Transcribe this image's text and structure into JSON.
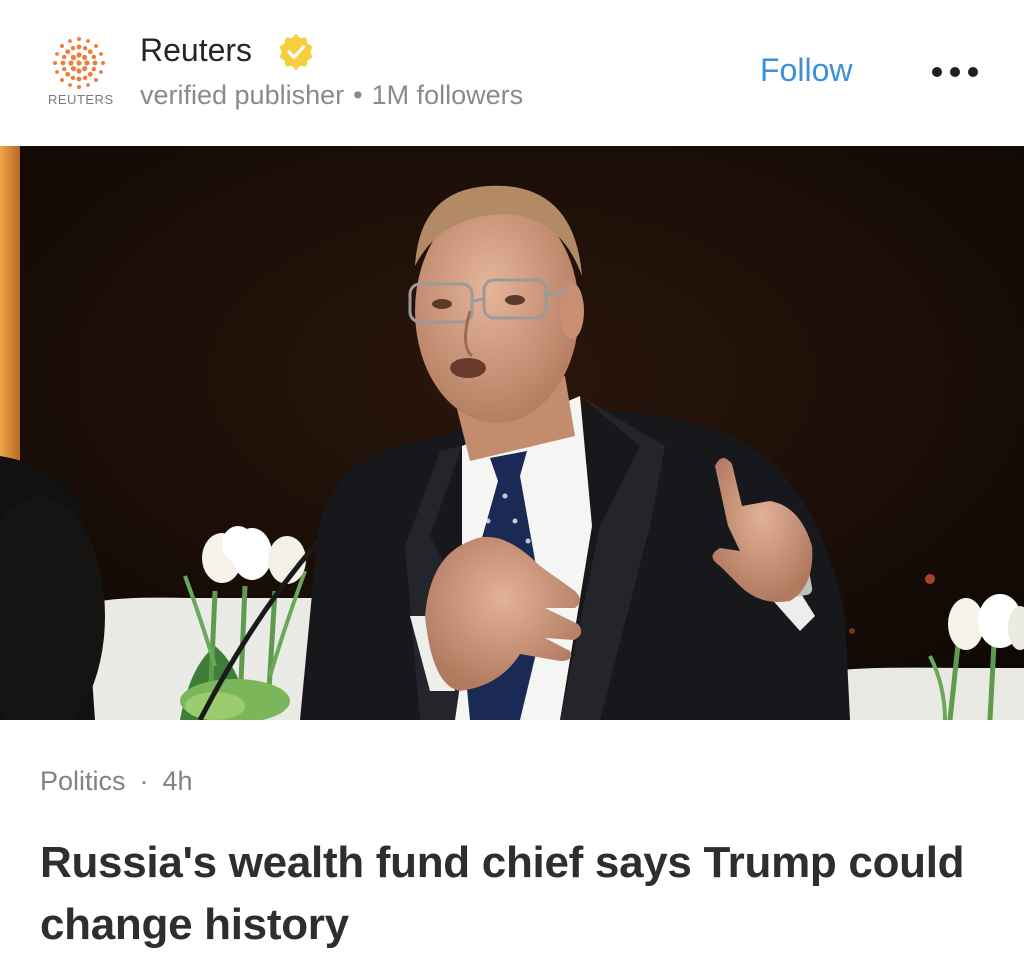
{
  "publisher": {
    "name": "Reuters",
    "logo_text": "REUTERS",
    "subtitle": "verified publisher",
    "separator": "•",
    "followers": "1M followers",
    "verified_icon": "verified-badge-icon",
    "brand_color": "#ee7d3b",
    "verified_color": "#f6cf3e"
  },
  "actions": {
    "follow_label": "Follow",
    "follow_color": "#3d8fdc",
    "more_icon": "more-horizontal-icon"
  },
  "hero_image": {
    "subject": "man in suit and glasses speaking at a microphone, white tulips in foreground"
  },
  "article": {
    "category": "Politics",
    "dot": "·",
    "age": "4h",
    "headline": "Russia's wealth fund chief says Trump could change history"
  }
}
